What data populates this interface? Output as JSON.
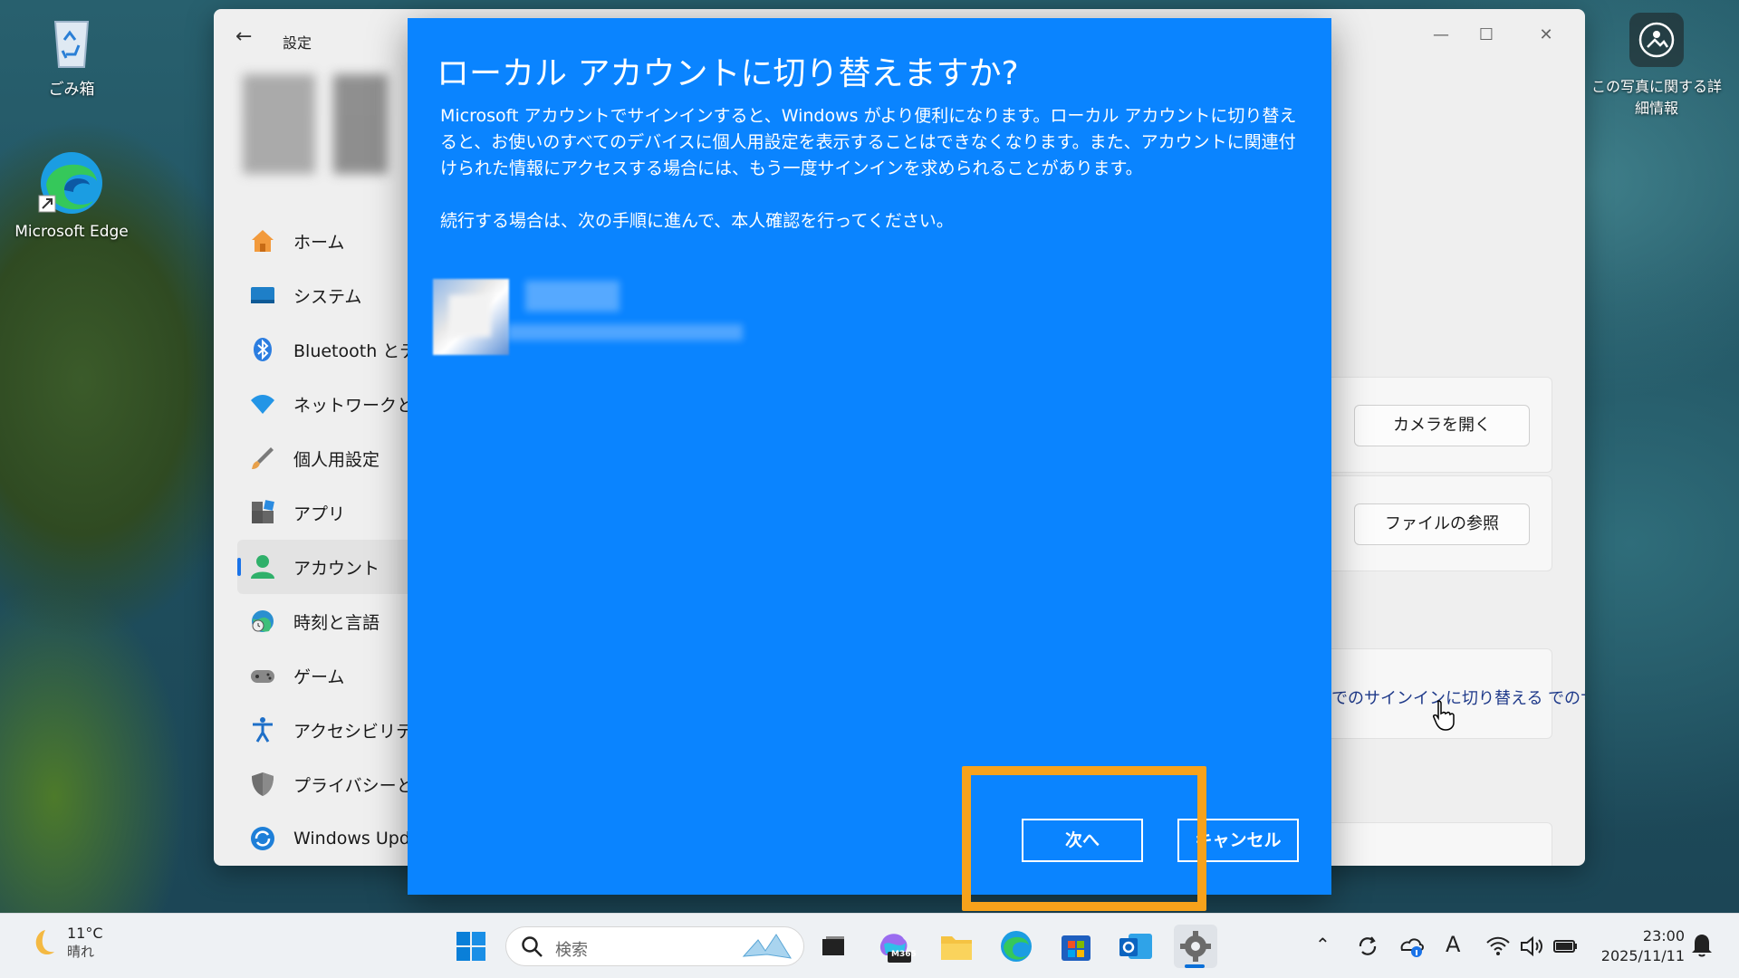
{
  "desktop": {
    "icons": [
      {
        "label": "ごみ箱",
        "icon": "recycle-bin-icon"
      },
      {
        "label": "Microsoft Edge",
        "icon": "edge-icon"
      }
    ],
    "photo_info": {
      "label": "この写真に関する詳細情報",
      "icon": "camera-info-icon"
    }
  },
  "settings": {
    "title": "設定",
    "nav": [
      {
        "label": "ホーム",
        "icon": "home-icon"
      },
      {
        "label": "システム",
        "icon": "system-icon"
      },
      {
        "label": "Bluetooth とデ",
        "icon": "bluetooth-icon"
      },
      {
        "label": "ネットワークとイ",
        "icon": "network-icon"
      },
      {
        "label": "個人用設定",
        "icon": "personalization-icon"
      },
      {
        "label": "アプリ",
        "icon": "apps-icon"
      },
      {
        "label": "アカウント",
        "icon": "account-icon",
        "active": true
      },
      {
        "label": "時刻と言語",
        "icon": "time-language-icon"
      },
      {
        "label": "ゲーム",
        "icon": "gaming-icon"
      },
      {
        "label": "アクセシビリティ",
        "icon": "accessibility-icon"
      },
      {
        "label": "プライバシーとセ",
        "icon": "privacy-icon"
      },
      {
        "label": "Windows Upd",
        "icon": "windows-update-icon"
      }
    ],
    "cards": {
      "camera_button": "カメラを開く",
      "browse_button": "ファイルの参照",
      "switch_link": "でのサインインに切り替える"
    }
  },
  "dialog": {
    "heading": "ローカル アカウントに切り替えますか?",
    "paragraph1": "Microsoft アカウントでサインインすると、Windows がより便利になります。ローカル アカウントに切り替えると、お使いのすべてのデバイスに個人用設定を表示することはできなくなります。また、アカウントに関連付けられた情報にアクセスする場合には、もう一度サインインを求められることがあります。",
    "paragraph2": "続行する場合は、次の手順に進んで、本人確認を行ってください。",
    "next_button": "次へ",
    "cancel_button": "キャンセル"
  },
  "taskbar": {
    "weather": {
      "temp": "11°C",
      "condition": "晴れ"
    },
    "search_placeholder": "検索",
    "m365_label": "M365",
    "clock": {
      "time": "23:00",
      "date": "2025/11/11"
    },
    "ime_label": "A"
  },
  "colors": {
    "dialog_bg": "#0a84ff",
    "highlight": "#f7a21b",
    "accent": "#1a73e8"
  }
}
